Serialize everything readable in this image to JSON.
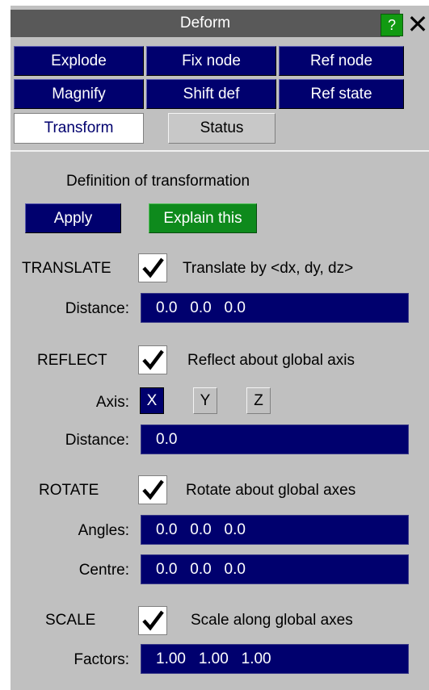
{
  "window": {
    "title": "Deform",
    "help_label": "?",
    "close_label": "✕"
  },
  "nav": {
    "row1": [
      "Explode",
      "Fix node",
      "Ref node"
    ],
    "row2": [
      "Magnify",
      "Shift def",
      "Ref state"
    ]
  },
  "tabs": {
    "transform": "Transform",
    "status": "Status",
    "active": "Transform"
  },
  "content": {
    "heading": "Definition of transformation",
    "apply_label": "Apply",
    "explain_label": "Explain this",
    "translate": {
      "label": "TRANSLATE",
      "checked": true,
      "desc": "Translate by <dx, dy, dz>",
      "distance_label": "Distance:",
      "distance_value": "0.0   0.0   0.0"
    },
    "reflect": {
      "label": "REFLECT",
      "checked": true,
      "desc": "Reflect about global axis",
      "axis_label": "Axis:",
      "axes": [
        "X",
        "Y",
        "Z"
      ],
      "selected_axis": "X",
      "distance_label": "Distance:",
      "distance_value": "0.0"
    },
    "rotate": {
      "label": "ROTATE",
      "checked": true,
      "desc": "Rotate about global axes",
      "angles_label": "Angles:",
      "angles_value": "0.0   0.0   0.0",
      "centre_label": "Centre:",
      "centre_value": "0.0   0.0   0.0"
    },
    "scale": {
      "label": "SCALE",
      "checked": true,
      "desc": "Scale along global axes",
      "factors_label": "Factors:",
      "factors_value": "1.00   1.00   1.00"
    }
  },
  "colors": {
    "panel_bg": "#c0c0c0",
    "button_navy": "#00006e",
    "button_green": "#0e8a1c",
    "title_bar": "#595959"
  }
}
